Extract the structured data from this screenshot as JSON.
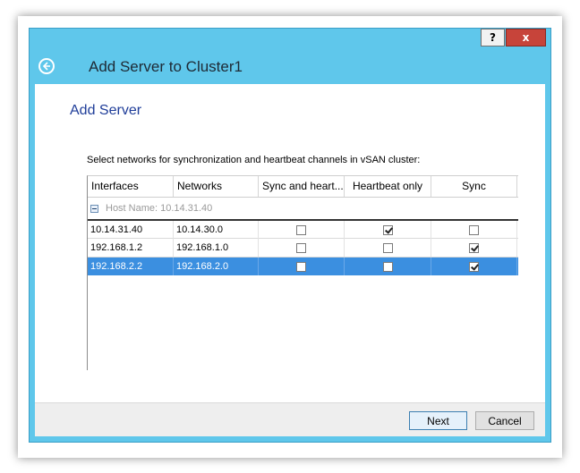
{
  "window": {
    "title": "Add Server to Cluster1",
    "help_label": "?",
    "close_label": "x",
    "back_icon": "back-arrow-icon",
    "colors": {
      "titlebar": "#5fc7eb",
      "close": "#c7443a",
      "selection": "#3b8fe0",
      "heading": "#1f3d99"
    }
  },
  "page": {
    "heading": "Add Server",
    "instruction": "Select networks for synchronization and heartbeat channels in vSAN cluster:"
  },
  "grid": {
    "columns": [
      "Interfaces",
      "Networks",
      "Sync and heart...",
      "Heartbeat only",
      "Sync"
    ],
    "group_label": "Host Name: 10.14.31.40",
    "rows": [
      {
        "interface": "10.14.31.40",
        "network": "10.14.30.0",
        "sync_and_heartbeat": false,
        "heartbeat_only": true,
        "sync": false,
        "selected": false
      },
      {
        "interface": "192.168.1.2",
        "network": "192.168.1.0",
        "sync_and_heartbeat": false,
        "heartbeat_only": false,
        "sync": true,
        "selected": false
      },
      {
        "interface": "192.168.2.2",
        "network": "192.168.2.0",
        "sync_and_heartbeat": false,
        "heartbeat_only": false,
        "sync": true,
        "selected": true
      }
    ]
  },
  "footer": {
    "next_label": "Next",
    "cancel_label": "Cancel"
  }
}
